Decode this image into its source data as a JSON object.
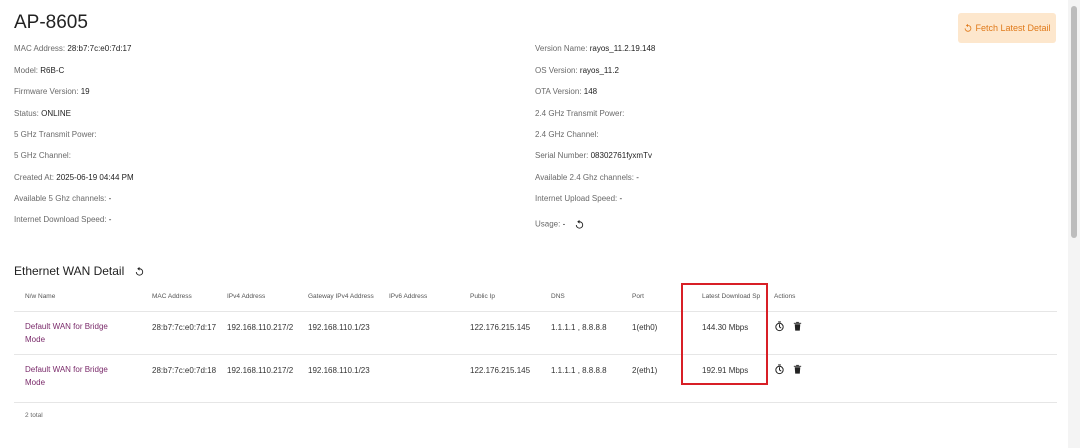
{
  "device": {
    "title": "AP-8605",
    "fetch_button": "Fetch Latest Detail"
  },
  "details_left": [
    {
      "label": "MAC Address:",
      "value": "28:b7:7c:e0:7d:17"
    },
    {
      "label": "Model:",
      "value": "R6B-C"
    },
    {
      "label": "Firmware Version:",
      "value": "19"
    },
    {
      "label": "Status:",
      "value": "ONLINE"
    },
    {
      "label": "5 GHz Transmit Power:",
      "value": ""
    },
    {
      "label": "5 GHz Channel:",
      "value": ""
    },
    {
      "label": "Created At:",
      "value": "2025-06-19 04:44 PM"
    },
    {
      "label": "Available 5 Ghz channels:",
      "value": "-"
    },
    {
      "label": "Internet Download Speed:",
      "value": "-"
    }
  ],
  "details_right": [
    {
      "label": "Version Name:",
      "value": "rayos_11.2.19.148"
    },
    {
      "label": "OS Version:",
      "value": "rayos_11.2"
    },
    {
      "label": "OTA Version:",
      "value": "148"
    },
    {
      "label": "2.4 GHz Transmit Power:",
      "value": ""
    },
    {
      "label": "2.4 GHz Channel:",
      "value": ""
    },
    {
      "label": "Serial Number:",
      "value": "08302761fyxmTv"
    },
    {
      "label": "Available 2.4 Ghz channels:",
      "value": "-"
    },
    {
      "label": "Internet Upload Speed:",
      "value": "-"
    },
    {
      "label": "Usage:",
      "value": "-"
    }
  ],
  "wan": {
    "title": "Ethernet WAN Detail",
    "headers": [
      "N/w Name",
      "MAC Address",
      "IPv4 Address",
      "Gateway IPv4 Address",
      "IPv6 Address",
      "Public Ip",
      "DNS",
      "Port",
      "Latest Download Sp",
      "Actions"
    ],
    "rows": [
      {
        "name": "Default WAN for Bridge Mode",
        "mac": "28:b7:7c:e0:7d:17",
        "ipv4": "192.168.110.217/2",
        "gateway": "192.168.110.1/23",
        "ipv6": "",
        "public_ip": "122.176.215.145",
        "dns": "1.1.1.1 , 8.8.8.8",
        "port": "1(eth0)",
        "download": "144.30 Mbps"
      },
      {
        "name": "Default WAN for Bridge Mode",
        "mac": "28:b7:7c:e0:7d:18",
        "ipv4": "192.168.110.217/2",
        "gateway": "192.168.110.1/23",
        "ipv6": "",
        "public_ip": "122.176.215.145",
        "dns": "1.1.1.1 , 8.8.8.8",
        "port": "2(eth1)",
        "download": "192.91 Mbps"
      }
    ],
    "total": "2 total"
  },
  "colors": {
    "accent": "#e07a1a",
    "link": "#7a2a6a",
    "highlight": "#d81f26"
  }
}
